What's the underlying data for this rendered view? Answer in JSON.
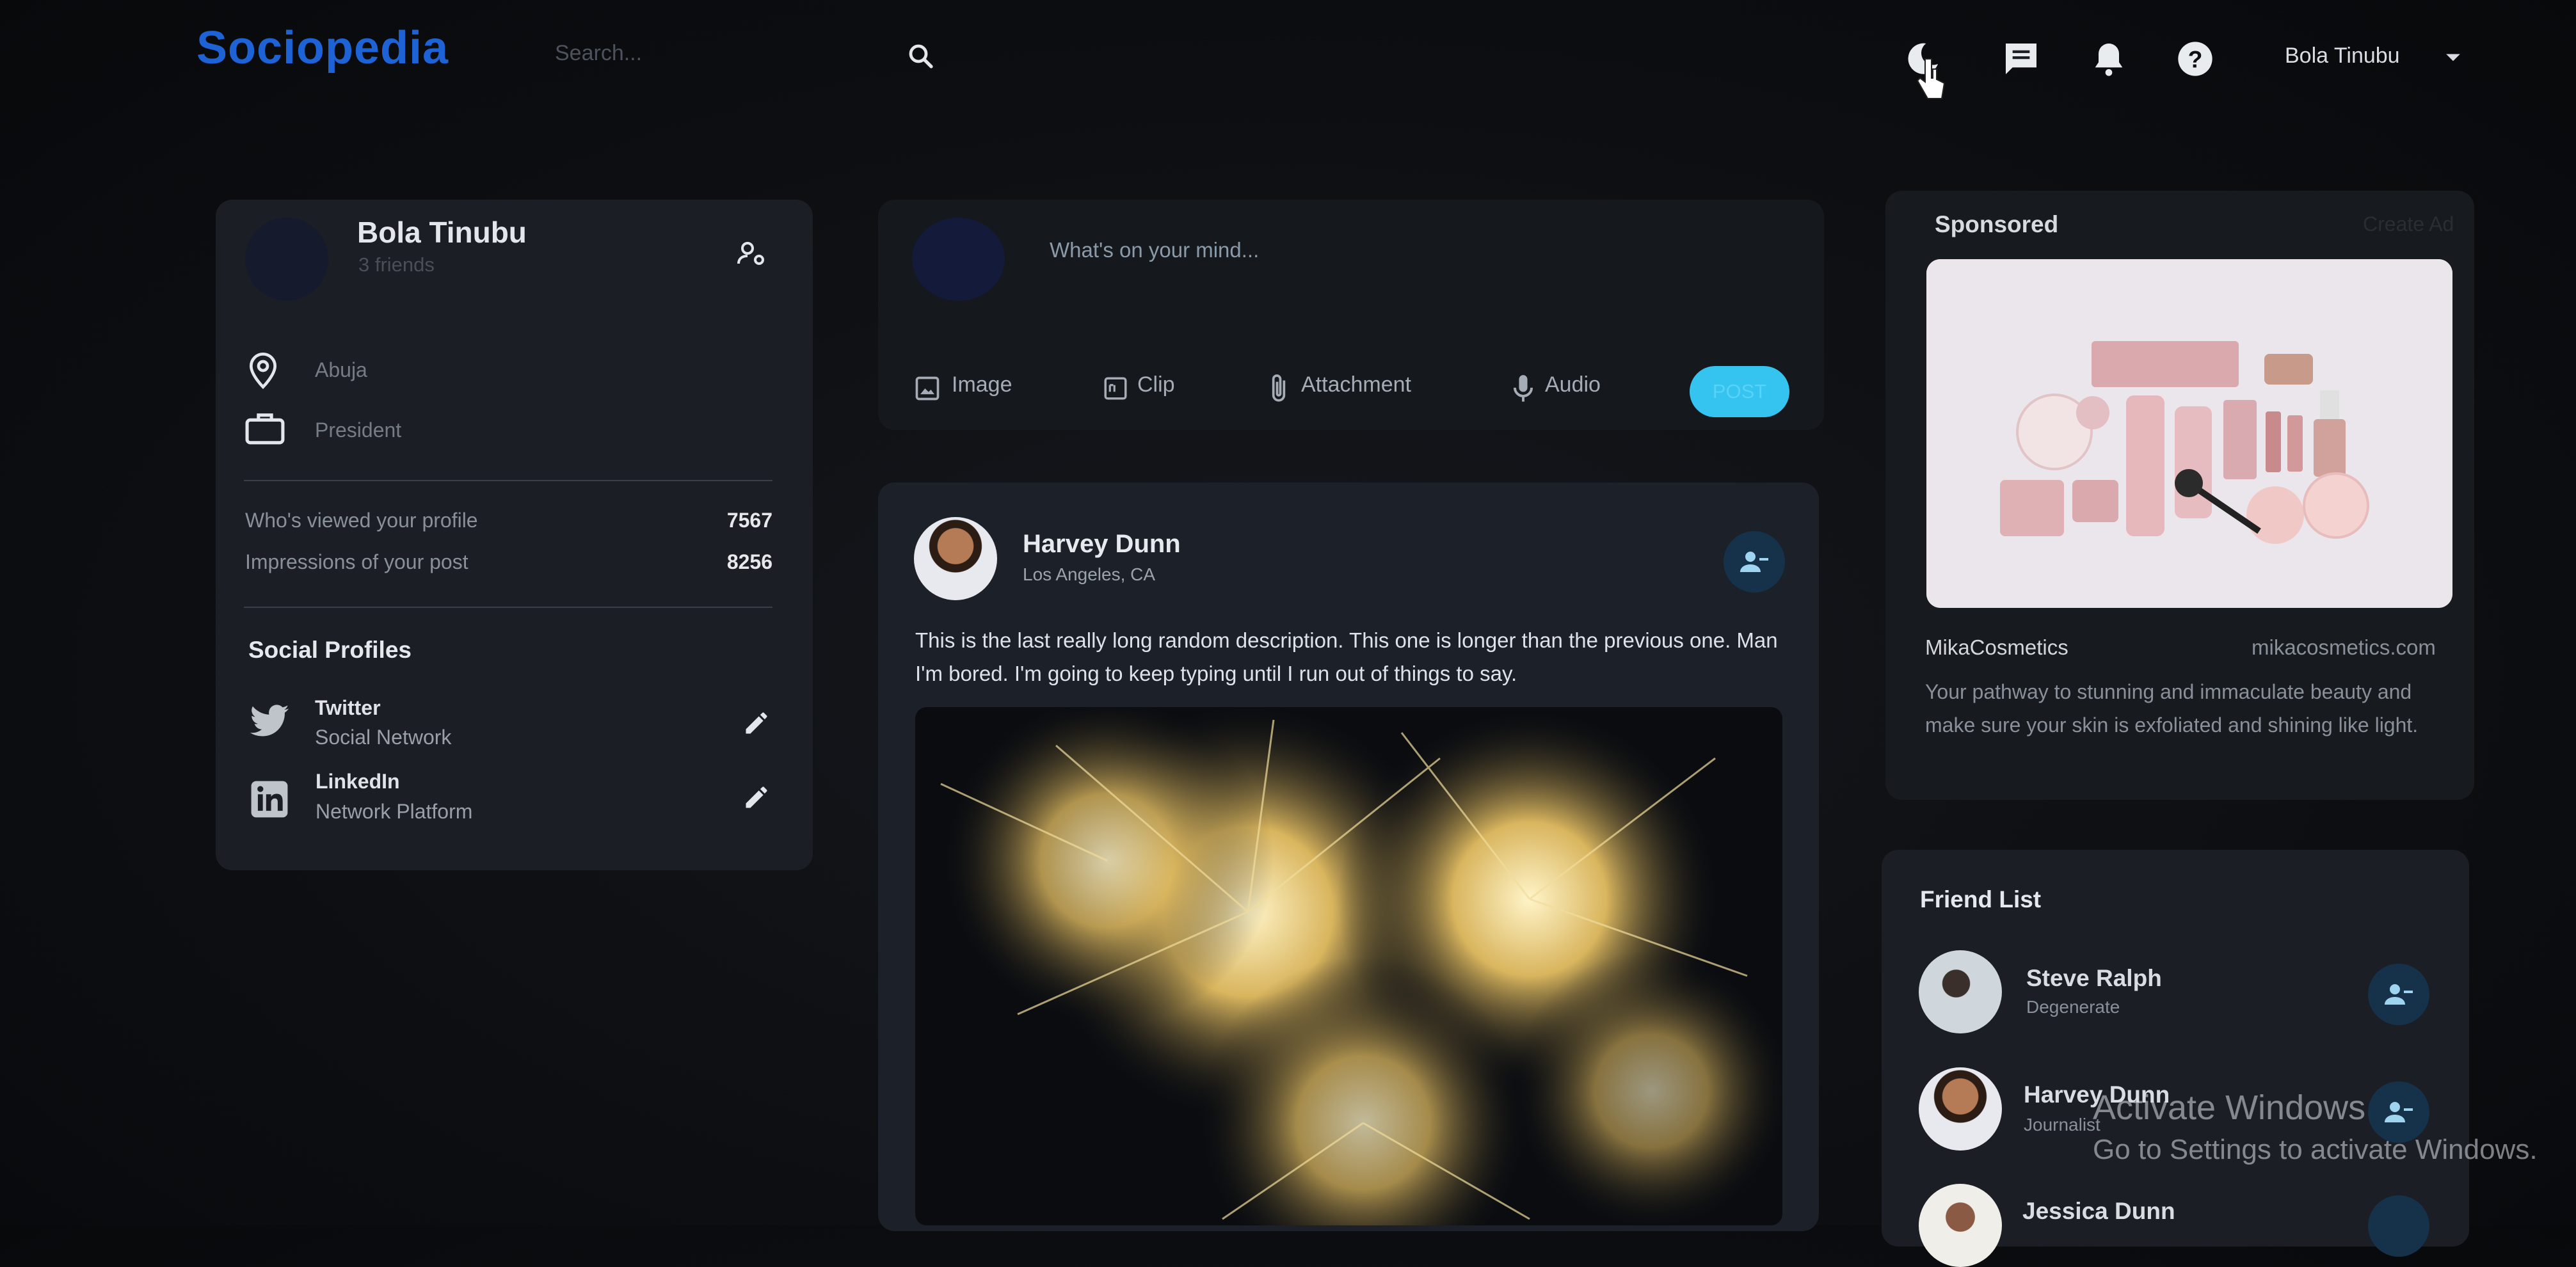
{
  "nav": {
    "logo": "Sociopedia",
    "search_placeholder": "Search...",
    "user_name": "Bola Tinubu"
  },
  "profile": {
    "name": "Bola Tinubu",
    "friends": "3 friends",
    "location": "Abuja",
    "occupation": "President",
    "stats": [
      {
        "label": "Who's viewed your profile",
        "value": "7567"
      },
      {
        "label": "Impressions of your post",
        "value": "8256"
      }
    ],
    "social_title": "Social Profiles",
    "socials": [
      {
        "name": "Twitter",
        "type": "Social Network"
      },
      {
        "name": "LinkedIn",
        "type": "Network Platform"
      }
    ]
  },
  "composer": {
    "placeholder": "What's on your mind...",
    "options": [
      "Image",
      "Clip",
      "Attachment",
      "Audio"
    ],
    "post_label": "POST"
  },
  "post": {
    "author": "Harvey Dunn",
    "location": "Los Angeles, CA",
    "description": "This is the last really long random description. This one is longer than the previous one. Man I'm bored. I'm going to keep typing until I run out of things to say."
  },
  "sponsored": {
    "title": "Sponsored",
    "create_ad": "Create Ad",
    "brand": "MikaCosmetics",
    "site": "mikacosmetics.com",
    "description": "Your pathway to stunning and immaculate beauty and make sure your skin is exfoliated and shining like light."
  },
  "friend_list": {
    "title": "Friend List",
    "friends": [
      {
        "name": "Steve Ralph",
        "occupation": "Degenerate"
      },
      {
        "name": "Harvey Dunn",
        "occupation": "Journalist"
      },
      {
        "name": "Jessica Dunn",
        "occupation": ""
      }
    ]
  },
  "watermark": {
    "title": "Activate Windows",
    "subtitle": "Go to Settings to activate Windows."
  },
  "colors": {
    "brand": "#1e63d6",
    "accent": "#35c4ef",
    "card": "#1b1e24"
  },
  "icons": [
    "search-icon",
    "dark-mode-icon",
    "message-icon",
    "notifications-icon",
    "help-icon",
    "manage-accounts-icon",
    "location-icon",
    "work-icon",
    "twitter-icon",
    "linkedin-icon",
    "edit-icon",
    "image-icon",
    "gif-icon",
    "attachment-icon",
    "mic-icon",
    "remove-friend-icon"
  ]
}
